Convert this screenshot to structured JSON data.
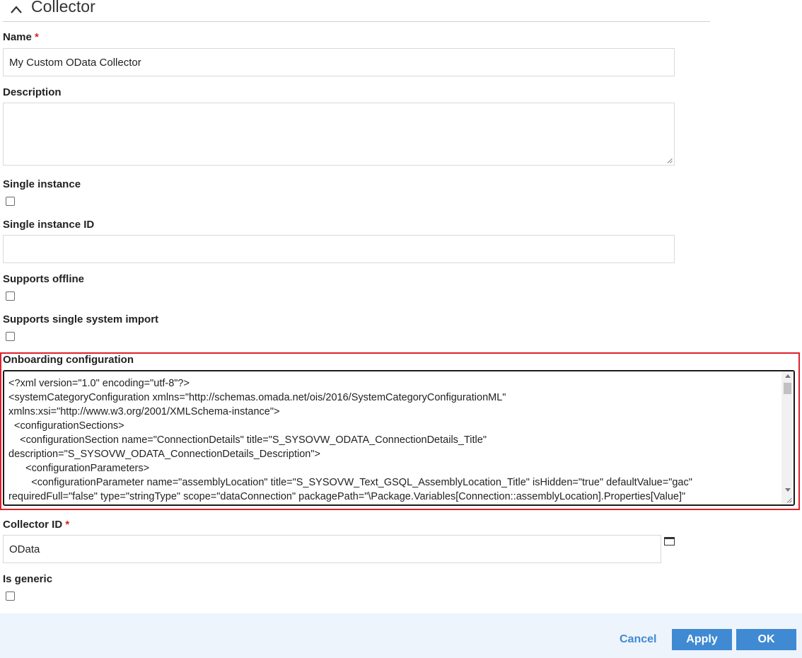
{
  "section": {
    "title": "Collector",
    "icon": "chevron-up-icon"
  },
  "fields": {
    "name": {
      "label": "Name",
      "required_mark": "*",
      "value": "My Custom OData Collector"
    },
    "description": {
      "label": "Description",
      "value": ""
    },
    "single_instance": {
      "label": "Single instance",
      "checked": false
    },
    "single_instance_id": {
      "label": "Single instance ID",
      "value": ""
    },
    "supports_offline": {
      "label": "Supports offline",
      "checked": false
    },
    "supports_single_system_import": {
      "label": "Supports single system import",
      "checked": false
    },
    "onboarding_configuration": {
      "label": "Onboarding configuration",
      "lines": [
        "<?xml version=\"1.0\" encoding=\"utf-8\"?>",
        "<systemCategoryConfiguration xmlns=\"http://schemas.omada.net/ois/2016/SystemCategoryConfigurationML\"",
        "xmlns:xsi=\"http://www.w3.org/2001/XMLSchema-instance\">",
        "  <configurationSections>",
        "    <configurationSection name=\"ConnectionDetails\" title=\"S_SYSOVW_ODATA_ConnectionDetails_Title\"",
        "description=\"S_SYSOVW_ODATA_ConnectionDetails_Description\">",
        "      <configurationParameters>",
        "        <configurationParameter name=\"assemblyLocation\" title=\"S_SYSOVW_Text_GSQL_AssemblyLocation_Title\" isHidden=\"true\" defaultValue=\"gac\"",
        "requiredFull=\"false\" type=\"stringType\" scope=\"dataConnection\" packagePath=\"\\Package.Variables[Connection::assemblyLocation].Properties[Value]\""
      ]
    },
    "collector_id": {
      "label": "Collector ID",
      "required_mark": "*",
      "value": "OData",
      "icon": "calculator-icon"
    },
    "is_generic": {
      "label": "Is generic",
      "checked": false
    }
  },
  "footer": {
    "cancel_label": "Cancel",
    "apply_label": "Apply",
    "ok_label": "OK"
  },
  "colors": {
    "accent": "#3f8ad2",
    "highlight": "#e0212a",
    "required": "#e02020",
    "footer_bg": "#edf4fc"
  }
}
